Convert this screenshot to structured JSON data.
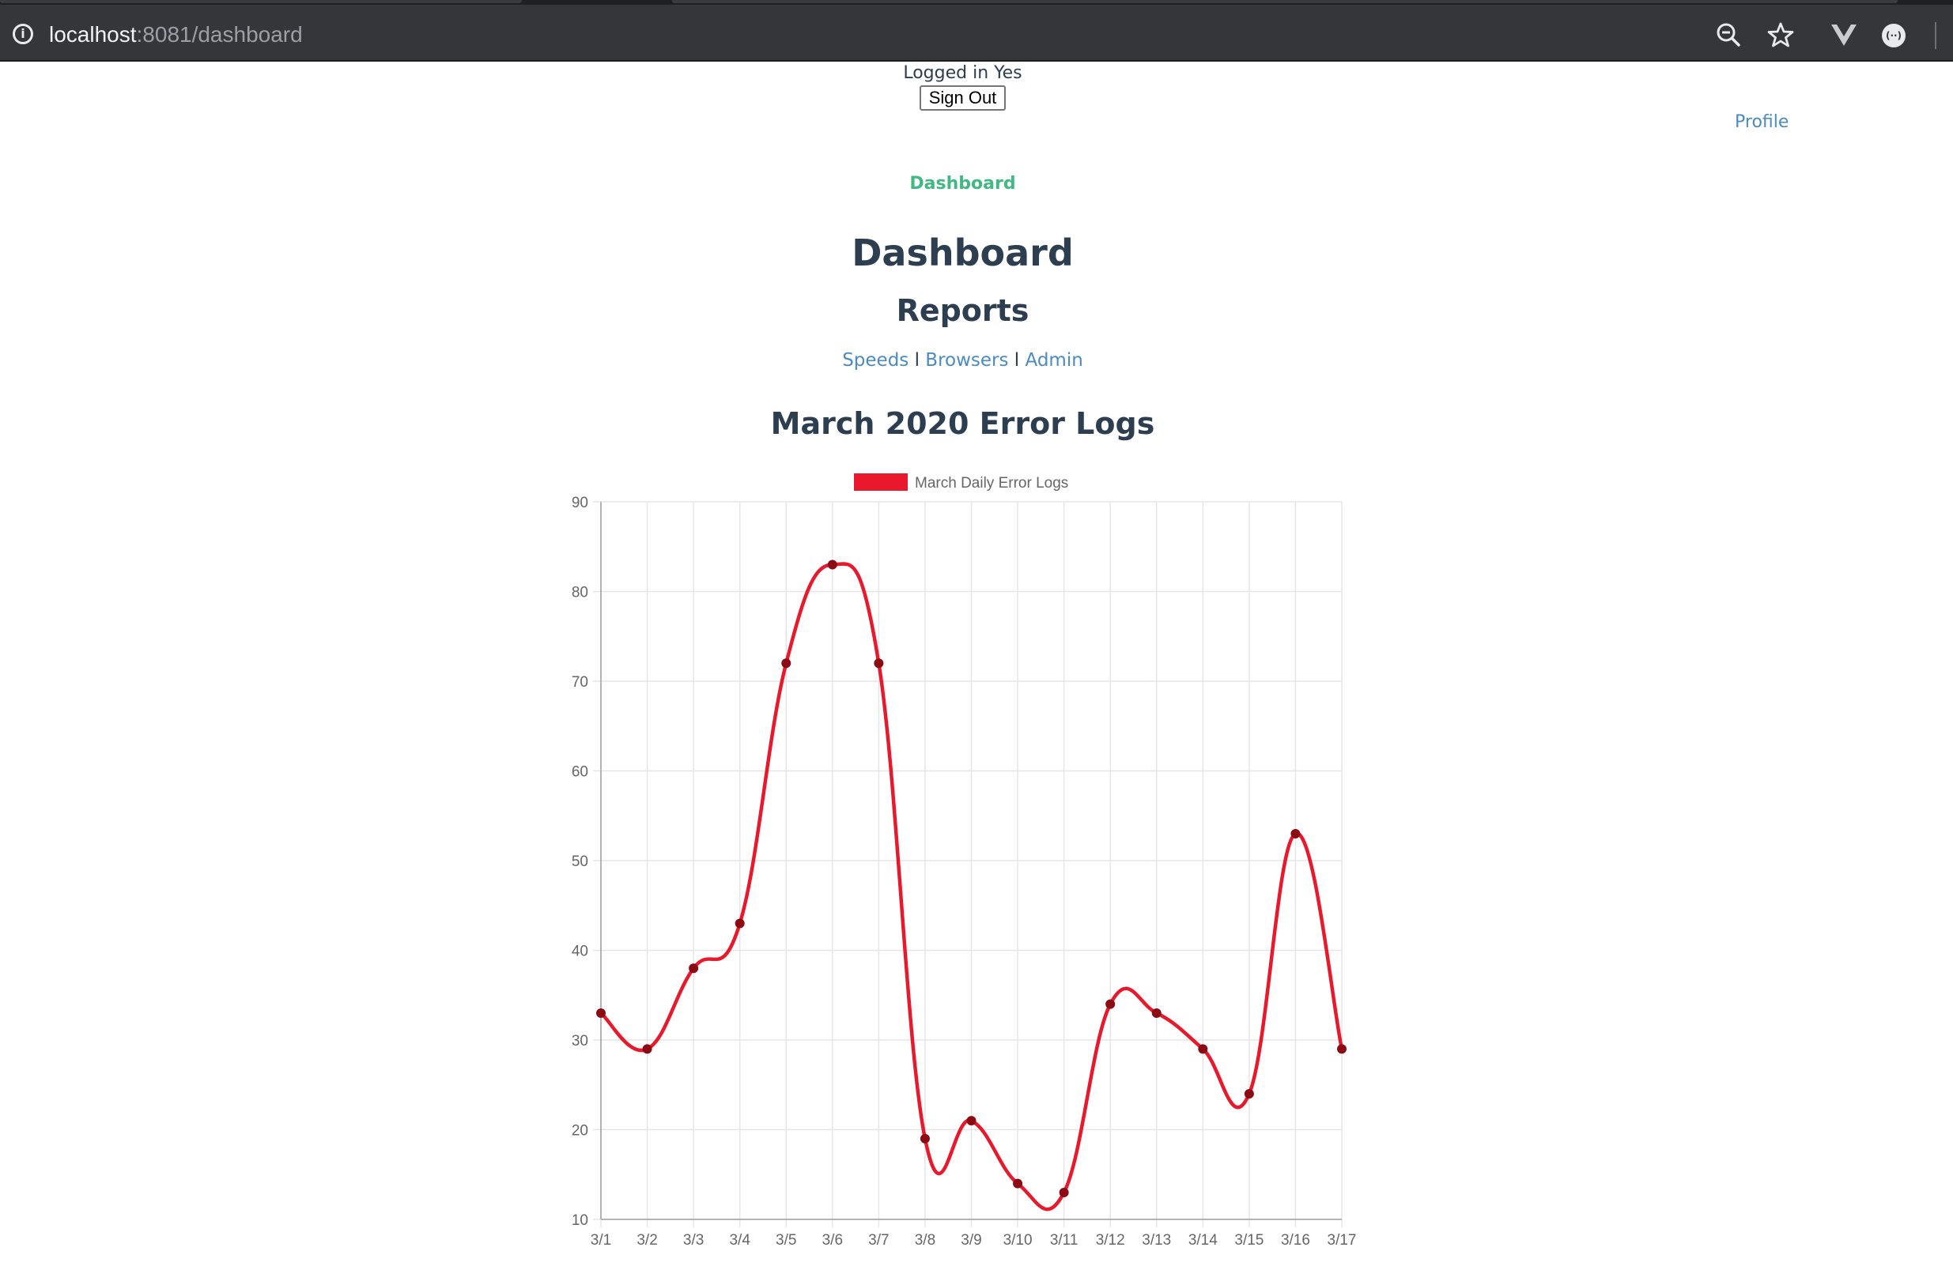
{
  "browser": {
    "url_host": "localhost",
    "url_rest": ":8081/dashboard",
    "icons": [
      "info-icon",
      "zoom-icon",
      "bookmark-star-icon",
      "vue-devtools-icon",
      "profile-avatar-icon"
    ]
  },
  "header": {
    "logged_in_text": "Logged in Yes",
    "sign_out_label": "Sign Out",
    "profile_link": "Profile"
  },
  "nav": {
    "dashboard_link": "Dashboard"
  },
  "main": {
    "title": "Dashboard",
    "subtitle": "Reports",
    "report_links": [
      "Speeds",
      "Browsers",
      "Admin"
    ],
    "separator": "l"
  },
  "chart_data": {
    "type": "line",
    "title": "March 2020 Error Logs",
    "categories": [
      "3/1",
      "3/2",
      "3/3",
      "3/4",
      "3/5",
      "3/6",
      "3/7",
      "3/8",
      "3/9",
      "3/10",
      "3/11",
      "3/12",
      "3/13",
      "3/14",
      "3/15",
      "3/16",
      "3/17"
    ],
    "series": [
      {
        "name": "March Daily Error Logs",
        "values": [
          33,
          29,
          38,
          43,
          72,
          83,
          72,
          19,
          21,
          14,
          13,
          34,
          33,
          29,
          24,
          53,
          29
        ],
        "color": "#e8192c",
        "point_color": "#8b0a14"
      }
    ],
    "yticks": [
      10,
      20,
      30,
      40,
      50,
      60,
      70,
      80,
      90
    ],
    "ylim": [
      10,
      90
    ],
    "grid": true,
    "smooth": true,
    "legend": "top-center"
  }
}
